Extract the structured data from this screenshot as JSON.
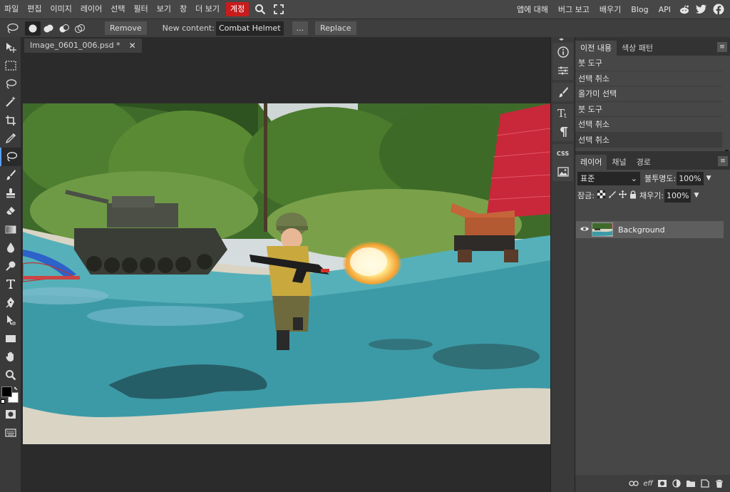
{
  "menubar": {
    "menus": [
      "파일",
      "편집",
      "이미지",
      "레이어",
      "선택",
      "필터",
      "보기",
      "창",
      "더 보기",
      "계정"
    ],
    "links": [
      "앱에 대해",
      "버그 보고",
      "배우기",
      "Blog",
      "API"
    ],
    "highlight_color": "#c81c1c"
  },
  "options": {
    "remove_label": "Remove",
    "new_content_label": "New content:",
    "new_content_value": "Combat Helmet",
    "more_label": "...",
    "replace_label": "Replace"
  },
  "document": {
    "tab_title": "Image_0601_006.psd *"
  },
  "history_panel": {
    "tabs": [
      "이전 내용",
      "색상 패턴"
    ],
    "items": [
      "붓 도구",
      "선택 취소",
      "올가미 선택",
      "붓 도구",
      "선택 취소",
      "선택 취소"
    ]
  },
  "layers_panel": {
    "tabs": [
      "레이어",
      "채널",
      "경로"
    ],
    "blend_mode": "표준",
    "opacity_label": "불투명도:",
    "opacity_value": "100%",
    "lock_label": "잠금:",
    "fill_label": "채우기:",
    "fill_value": "100%",
    "layers": [
      {
        "name": "Background",
        "visible": true
      }
    ]
  },
  "icon_strip": {
    "css_label": "CSS"
  },
  "colors": {
    "accent": "#5aa0ff",
    "foreground": "#000000",
    "background": "#ffffff"
  }
}
